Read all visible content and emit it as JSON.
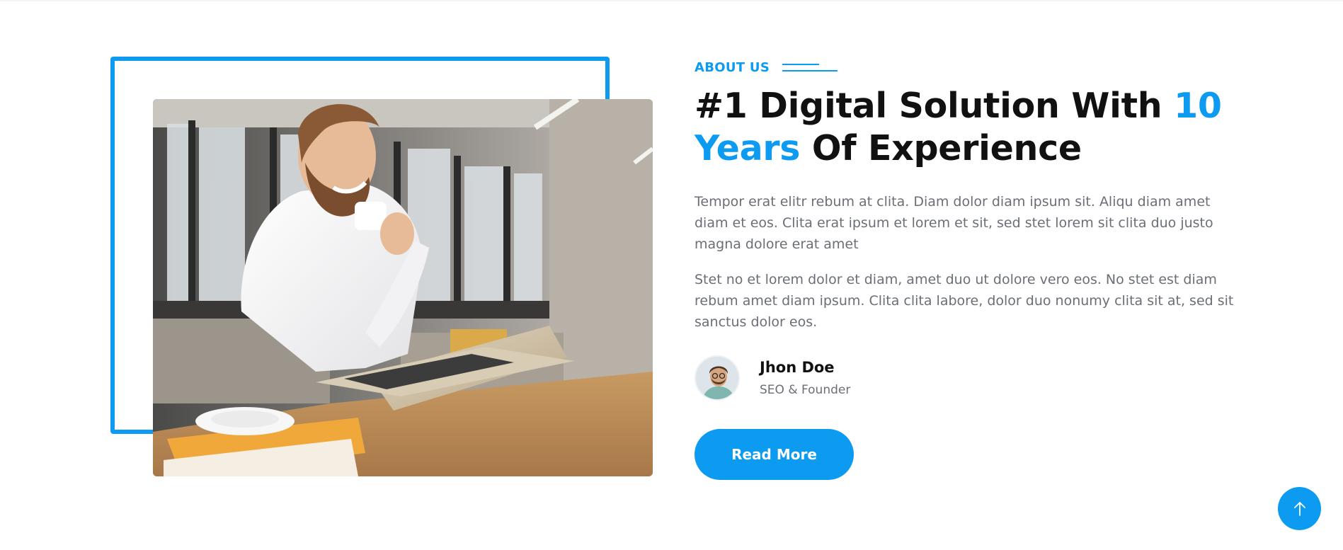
{
  "about": {
    "eyebrow": "ABOUT US",
    "headline": {
      "part1": "#1 Digital Solution With ",
      "accent": "10 Years",
      "part2": " Of Experience"
    },
    "paragraphs": [
      "Tempor erat elitr rebum at clita. Diam dolor diam ipsum sit. Aliqu diam amet diam et eos. Clita erat ipsum et lorem et sit, sed stet lorem sit clita duo justo magna dolore erat amet",
      "Stet no et lorem dolor et diam, amet duo ut dolore vero eos. No stet est diam rebum amet diam ipsum. Clita clita labore, dolor duo nonumy clita sit at, sed sit sanctus dolor eos."
    ],
    "author": {
      "name": "Jhon Doe",
      "role": "SEO & Founder"
    },
    "cta_label": "Read More"
  },
  "icons": {
    "back_to_top": "arrow-up-icon"
  },
  "colors": {
    "accent": "#0d9bf2",
    "heading": "#111111",
    "body_text": "#6b6f75"
  }
}
